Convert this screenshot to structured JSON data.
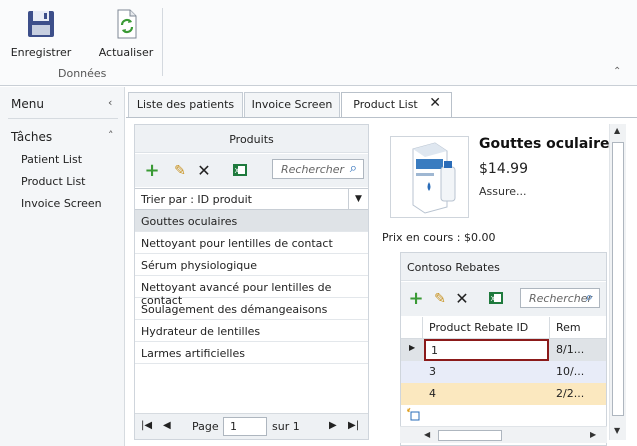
{
  "ribbon": {
    "save_label": "Enregistrer",
    "refresh_label": "Actualiser",
    "group_label": "Données"
  },
  "nav": {
    "menu_label": "Menu",
    "tasks_label": "Tâches",
    "items": [
      "Patient List",
      "Product List",
      "Invoice Screen"
    ]
  },
  "tabs": [
    {
      "label": "Liste des patients"
    },
    {
      "label": "Invoice Screen"
    },
    {
      "label": "Product List"
    }
  ],
  "products": {
    "title": "Produits",
    "search_placeholder": "Rechercher",
    "sort_label": "Trier par : ID produit",
    "items": [
      "Gouttes oculaires",
      "Nettoyant pour lentilles de contact",
      "Sérum physiologique",
      "Nettoyant avancé pour lentilles de contact",
      "Soulagement des démangeaisons",
      "Hydrateur de lentilles",
      "Larmes artificielles"
    ],
    "pager": {
      "page_label": "Page",
      "page_value": "1",
      "of_label": "sur 1"
    }
  },
  "detail": {
    "name": "Gouttes oculaires",
    "price": "$14.99",
    "description": "Assure...",
    "current_price": "Prix en cours : $0.00"
  },
  "rebates": {
    "title": "Contoso Rebates",
    "search_placeholder": "Rechercher",
    "columns": [
      "Product Rebate ID",
      "Rem"
    ],
    "rows": [
      {
        "id": "1",
        "rem": "8/1..."
      },
      {
        "id": "3",
        "rem": "10/..."
      },
      {
        "id": "4",
        "rem": "2/2..."
      }
    ]
  },
  "colors": {
    "accent_blue": "#2a6cb8",
    "add_green": "#3a9a35",
    "row_selected": "#dfe3e7",
    "row_alt_blue": "#e8ecf8",
    "row_alt_yellow": "#fbe8bf",
    "current_cell_border": "#8b1a1a"
  }
}
